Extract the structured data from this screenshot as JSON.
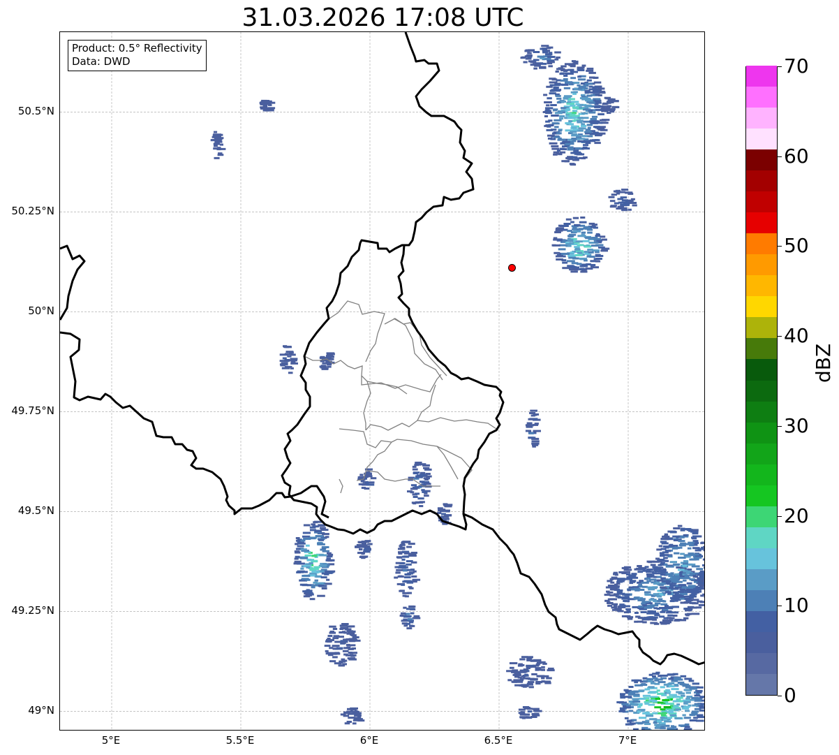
{
  "title": "31.03.2026 17:08 UTC",
  "info": {
    "product_line": "Product: 0.5° Reflectivity",
    "data_line": "Data: DWD"
  },
  "axes": {
    "lon_ticks": [
      {
        "value": 5.0,
        "label": "5°E"
      },
      {
        "value": 5.5,
        "label": "5.5°E"
      },
      {
        "value": 6.0,
        "label": "6°E"
      },
      {
        "value": 6.5,
        "label": "6.5°E"
      },
      {
        "value": 7.0,
        "label": "7°E"
      }
    ],
    "lat_ticks": [
      {
        "value": 50.5,
        "label": "50.5°N"
      },
      {
        "value": 50.25,
        "label": "50.25°N"
      },
      {
        "value": 50.0,
        "label": "50°N"
      },
      {
        "value": 49.75,
        "label": "49.75°N"
      },
      {
        "value": 49.5,
        "label": "49.5°N"
      },
      {
        "value": 49.25,
        "label": "49.25°N"
      },
      {
        "value": 49.0,
        "label": "49°N"
      }
    ],
    "lon_range": [
      4.8,
      7.3
    ],
    "lat_range": [
      48.95,
      50.7
    ],
    "grid": true
  },
  "radar_site": {
    "lon": 6.55,
    "lat": 50.11,
    "color": "#ff0000"
  },
  "colorbar": {
    "unit": "dBZ",
    "range": [
      0,
      70
    ],
    "step": 2.5,
    "labels": [
      {
        "value": 0,
        "label": "0"
      },
      {
        "value": 10,
        "label": "10"
      },
      {
        "value": 20,
        "label": "20"
      },
      {
        "value": 30,
        "label": "30"
      },
      {
        "value": 40,
        "label": "40"
      },
      {
        "value": 50,
        "label": "50"
      },
      {
        "value": 60,
        "label": "60"
      },
      {
        "value": 70,
        "label": "70"
      }
    ],
    "colors": [
      "#6577a9",
      "#5769a2",
      "#4a5f9e",
      "#4360a3",
      "#4d80b6",
      "#5a9cc6",
      "#67c3dc",
      "#5fd6c4",
      "#3dd675",
      "#15c621",
      "#13b61c",
      "#12a519",
      "#0f9314",
      "#0e7e12",
      "#0c6a0f",
      "#085a0c",
      "#477a0a",
      "#adb30a",
      "#ffd700",
      "#ffb700",
      "#ff9a00",
      "#ff7b00",
      "#e60000",
      "#c00000",
      "#a30000",
      "#7b0000",
      "#ffe1ff",
      "#ffb3ff",
      "#ff70ff",
      "#ee36ee"
    ]
  },
  "echoes": [
    {
      "lon": 6.78,
      "lat": 50.5,
      "rlon": 0.12,
      "rlat": 0.13,
      "dbz": 6,
      "core": 20
    },
    {
      "lon": 6.8,
      "lat": 50.17,
      "rlon": 0.1,
      "rlat": 0.07,
      "dbz": 6,
      "core": 22
    },
    {
      "lon": 6.97,
      "lat": 50.28,
      "rlon": 0.05,
      "rlat": 0.03,
      "dbz": 5,
      "core": 10
    },
    {
      "lon": 6.65,
      "lat": 50.64,
      "rlon": 0.07,
      "rlat": 0.03,
      "dbz": 5,
      "core": 13
    },
    {
      "lon": 6.92,
      "lat": 50.52,
      "rlon": 0.03,
      "rlat": 0.02,
      "dbz": 5,
      "core": 8
    },
    {
      "lon": 5.59,
      "lat": 50.52,
      "rlon": 0.02,
      "rlat": 0.015,
      "dbz": 5,
      "core": 8
    },
    {
      "lon": 5.4,
      "lat": 50.42,
      "rlon": 0.02,
      "rlat": 0.035,
      "dbz": 5,
      "core": 8
    },
    {
      "lon": 5.67,
      "lat": 49.88,
      "rlon": 0.025,
      "rlat": 0.04,
      "dbz": 5,
      "core": 9
    },
    {
      "lon": 5.77,
      "lat": 49.38,
      "rlon": 0.07,
      "rlat": 0.1,
      "dbz": 6,
      "core": 22
    },
    {
      "lon": 5.97,
      "lat": 49.41,
      "rlon": 0.03,
      "rlat": 0.025,
      "dbz": 5,
      "core": 9
    },
    {
      "lon": 6.13,
      "lat": 49.36,
      "rlon": 0.04,
      "rlat": 0.07,
      "dbz": 5,
      "core": 12
    },
    {
      "lon": 6.14,
      "lat": 49.24,
      "rlon": 0.03,
      "rlat": 0.03,
      "dbz": 5,
      "core": 14
    },
    {
      "lon": 5.88,
      "lat": 49.17,
      "rlon": 0.06,
      "rlat": 0.06,
      "dbz": 5,
      "core": 8
    },
    {
      "lon": 5.92,
      "lat": 48.99,
      "rlon": 0.04,
      "rlat": 0.02,
      "dbz": 5,
      "core": 8
    },
    {
      "lon": 6.61,
      "lat": 49.1,
      "rlon": 0.09,
      "rlat": 0.04,
      "dbz": 5,
      "core": 9
    },
    {
      "lon": 6.6,
      "lat": 49.0,
      "rlon": 0.04,
      "rlat": 0.015,
      "dbz": 5,
      "core": 8
    },
    {
      "lon": 7.1,
      "lat": 49.3,
      "rlon": 0.2,
      "rlat": 0.08,
      "dbz": 6,
      "core": 15
    },
    {
      "lon": 7.2,
      "lat": 49.37,
      "rlon": 0.1,
      "rlat": 0.1,
      "dbz": 7,
      "core": 16
    },
    {
      "lon": 7.12,
      "lat": 49.02,
      "rlon": 0.17,
      "rlat": 0.08,
      "dbz": 8,
      "core": 25
    },
    {
      "lon": 6.62,
      "lat": 49.71,
      "rlon": 0.02,
      "rlat": 0.05,
      "dbz": 5,
      "core": 12
    },
    {
      "lon": 6.18,
      "lat": 49.57,
      "rlon": 0.04,
      "rlat": 0.06,
      "dbz": 5,
      "core": 13
    },
    {
      "lon": 5.98,
      "lat": 49.58,
      "rlon": 0.03,
      "rlat": 0.03,
      "dbz": 5,
      "core": 9
    },
    {
      "lon": 6.28,
      "lat": 49.5,
      "rlon": 0.02,
      "rlat": 0.03,
      "dbz": 5,
      "core": 8
    },
    {
      "lon": 5.82,
      "lat": 49.88,
      "rlon": 0.02,
      "rlat": 0.03,
      "dbz": 5,
      "core": 8
    }
  ]
}
